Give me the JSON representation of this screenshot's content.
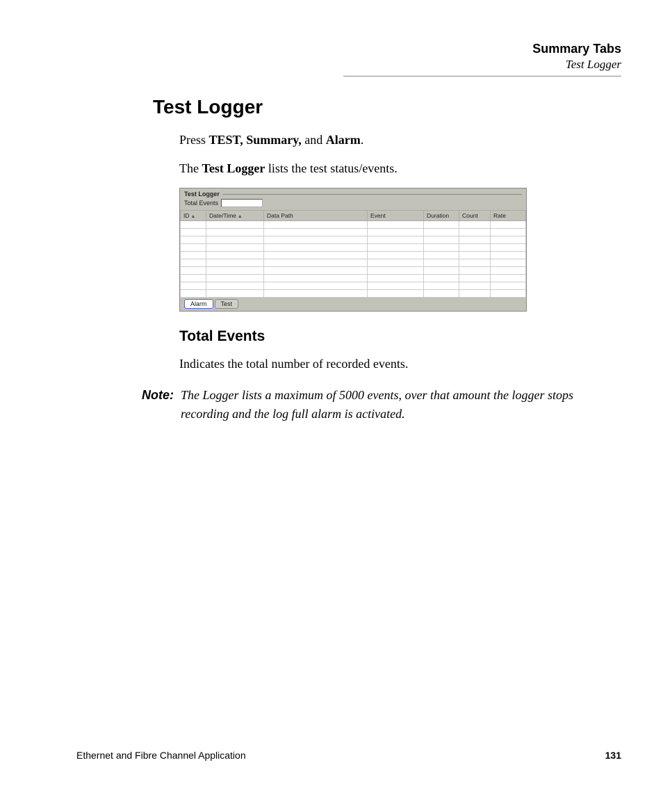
{
  "header": {
    "chapter": "Summary Tabs",
    "section": "Test Logger"
  },
  "title": "Test Logger",
  "para1": {
    "prefix": "Press ",
    "b1": "TEST, Summary,",
    "mid": " and ",
    "b2": "Alarm",
    "suffix": "."
  },
  "para2": {
    "prefix": "The ",
    "b1": "Test Logger",
    "suffix": " lists the test status/events."
  },
  "ui": {
    "legend": "Test Logger",
    "total_label": "Total Events",
    "total_value": "",
    "columns": [
      "ID",
      "Date/Time",
      "Data Path",
      "Event",
      "Duration",
      "Count",
      "Rate"
    ],
    "sort_indicator": "▲",
    "rows": [
      [],
      [],
      [],
      [],
      [],
      [],
      [],
      [],
      [],
      []
    ],
    "tabs": {
      "active": "Alarm",
      "inactive": "Test"
    }
  },
  "subhead": "Total Events",
  "para3": "Indicates the total number of recorded events.",
  "note": {
    "label": "Note:",
    "text": "The Logger lists a maximum of 5000 events, over that amount the logger stops recording and the log full alarm is activated."
  },
  "footer": {
    "doc": "Ethernet and Fibre Channel Application",
    "page": "131"
  }
}
